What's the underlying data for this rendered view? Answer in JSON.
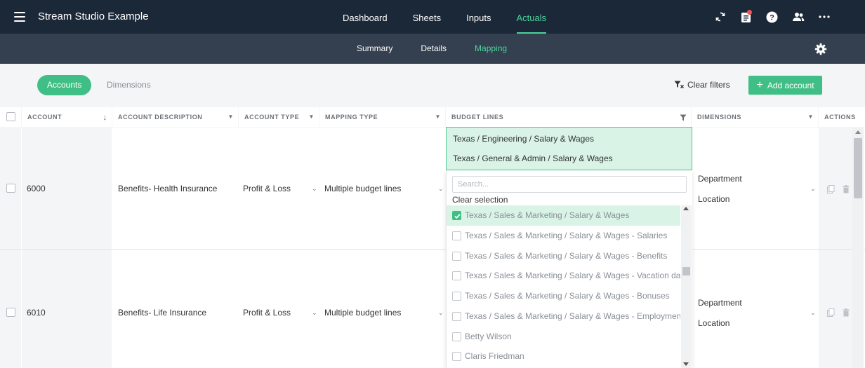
{
  "app": {
    "title": "Stream Studio Example"
  },
  "main_nav": [
    {
      "label": "Dashboard"
    },
    {
      "label": "Sheets"
    },
    {
      "label": "Inputs"
    },
    {
      "label": "Actuals"
    }
  ],
  "main_nav_active": "Actuals",
  "top_icons": [
    "sync-icon",
    "notes-icon",
    "help-icon",
    "users-icon",
    "more-icon"
  ],
  "sub_nav": [
    {
      "label": "Summary"
    },
    {
      "label": "Details"
    },
    {
      "label": "Mapping"
    }
  ],
  "sub_nav_active": "Mapping",
  "toolbar": {
    "tab_accounts": "Accounts",
    "tab_dimensions": "Dimensions",
    "clear_filters": "Clear filters",
    "add_account": "Add account"
  },
  "table": {
    "headers": {
      "account": "ACCOUNT",
      "description": "ACCOUNT DESCRIPTION",
      "type": "ACCOUNT TYPE",
      "mapping": "MAPPING TYPE",
      "budget": "BUDGET LINES",
      "dimensions": "DIMENSIONS",
      "actions": "ACTIONS"
    },
    "rows": [
      {
        "account": "6000",
        "description": "Benefits- Health Insurance",
        "type": "Profit & Loss",
        "mapping": "Multiple budget lines",
        "dimensions": [
          "Department",
          "Location"
        ]
      },
      {
        "account": "6010",
        "description": "Benefits- Life Insurance",
        "type": "Profit & Loss",
        "mapping": "Multiple budget lines",
        "dimensions": [
          "Department",
          "Location"
        ]
      }
    ]
  },
  "budget_lines": {
    "selected": [
      "Texas / Engineering / Salary & Wages",
      "Texas / General & Admin / Salary & Wages"
    ],
    "search_placeholder": "Search...",
    "clear_selection": "Clear selection",
    "options": [
      {
        "label": "Texas / Sales & Marketing / Salary & Wages",
        "checked": true
      },
      {
        "label": "Texas / Sales & Marketing / Salary & Wages - Salaries",
        "checked": false
      },
      {
        "label": "Texas / Sales & Marketing / Salary & Wages - Benefits",
        "checked": false
      },
      {
        "label": "Texas / Sales & Marketing / Salary & Wages - Vacation days",
        "checked": false
      },
      {
        "label": "Texas / Sales & Marketing / Salary & Wages - Bonuses",
        "checked": false
      },
      {
        "label": "Texas / Sales & Marketing / Salary & Wages - Employment Ta",
        "checked": false
      },
      {
        "label": "Betty Wilson",
        "checked": false
      },
      {
        "label": "Claris Friedman",
        "checked": false
      }
    ]
  },
  "colors": {
    "topbar": "#1b2838",
    "subbar": "#34404f",
    "accent": "#3fbf85",
    "active_nav": "#4cd39a",
    "selection_bg": "#d9f3e7"
  }
}
